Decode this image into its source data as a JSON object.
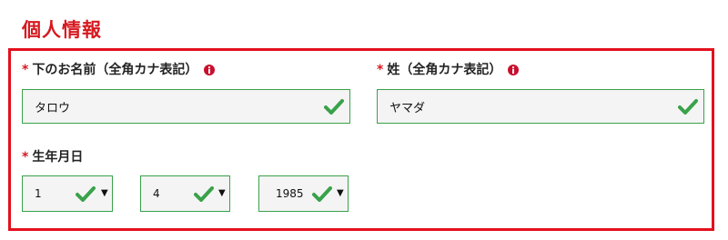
{
  "section": {
    "title": "個人情報"
  },
  "colors": {
    "accent": "#d71920",
    "valid": "#39a24a"
  },
  "fields": {
    "first_name": {
      "required_mark": "*",
      "label": "下のお名前（全角カナ表記）",
      "value": "タロウ",
      "info_icon": "info-icon",
      "status_icon": "check-icon"
    },
    "last_name": {
      "required_mark": "*",
      "label": "姓（全角カナ表記）",
      "value": "ヤマダ",
      "info_icon": "info-icon",
      "status_icon": "check-icon"
    },
    "birthdate": {
      "required_mark": "*",
      "label": "生年月日",
      "day": "1",
      "month": "4",
      "year": "1985",
      "caret": "▼"
    }
  }
}
